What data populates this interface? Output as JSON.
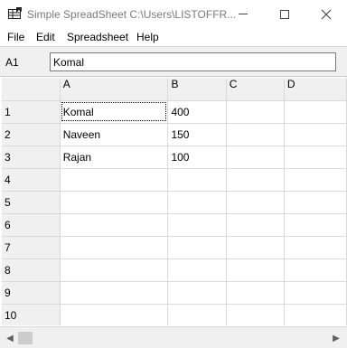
{
  "window": {
    "title": "Simple SpreadSheet C:\\Users\\LISTOFFR...",
    "icon": "spreadsheet-app-icon"
  },
  "menu": {
    "file": "File",
    "edit": "Edit",
    "spreadsheet": "Spreadsheet",
    "help": "Help"
  },
  "formula_bar": {
    "cell_ref": "A1",
    "value": "Komal"
  },
  "grid": {
    "columns": [
      "A",
      "B",
      "C",
      "D"
    ],
    "rows": [
      {
        "label": "1",
        "cells": [
          "Komal",
          "400",
          "",
          ""
        ]
      },
      {
        "label": "2",
        "cells": [
          "Naveen",
          "150",
          "",
          ""
        ]
      },
      {
        "label": "3",
        "cells": [
          "Rajan",
          "100",
          "",
          ""
        ]
      },
      {
        "label": "4",
        "cells": [
          "",
          "",
          "",
          ""
        ]
      },
      {
        "label": "5",
        "cells": [
          "",
          "",
          "",
          ""
        ]
      },
      {
        "label": "6",
        "cells": [
          "",
          "",
          "",
          ""
        ]
      },
      {
        "label": "7",
        "cells": [
          "",
          "",
          "",
          ""
        ]
      },
      {
        "label": "8",
        "cells": [
          "",
          "",
          "",
          ""
        ]
      },
      {
        "label": "9",
        "cells": [
          "",
          "",
          "",
          ""
        ]
      },
      {
        "label": "10",
        "cells": [
          "",
          "",
          "",
          ""
        ]
      }
    ],
    "selected_cell": "A1"
  },
  "colors": {
    "chrome": "#f0f0f0",
    "grid_line": "#d9d9d9",
    "header_border": "#7a7a7a",
    "title_text": "#7a7a7a"
  }
}
